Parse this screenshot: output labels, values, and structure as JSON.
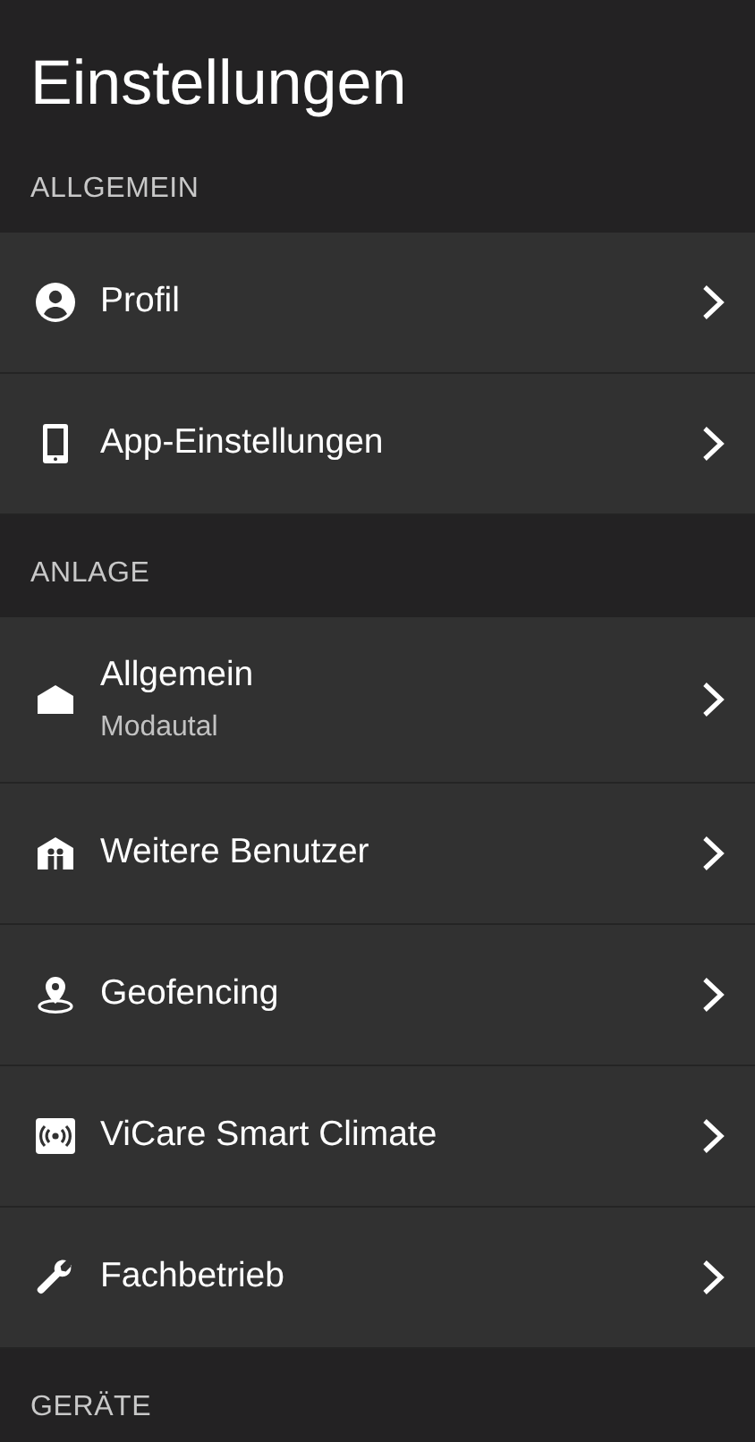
{
  "title": "Einstellungen",
  "sections": [
    {
      "title": "ALLGEMEIN",
      "items": [
        {
          "label": "Profil"
        },
        {
          "label": "App-Einstellungen"
        }
      ]
    },
    {
      "title": "ANLAGE",
      "items": [
        {
          "label": "Allgemein",
          "sublabel": "Modautal"
        },
        {
          "label": "Weitere Benutzer"
        },
        {
          "label": "Geofencing"
        },
        {
          "label": "ViCare Smart Climate"
        },
        {
          "label": "Fachbetrieb"
        }
      ]
    },
    {
      "title": "GERÄTE"
    }
  ]
}
